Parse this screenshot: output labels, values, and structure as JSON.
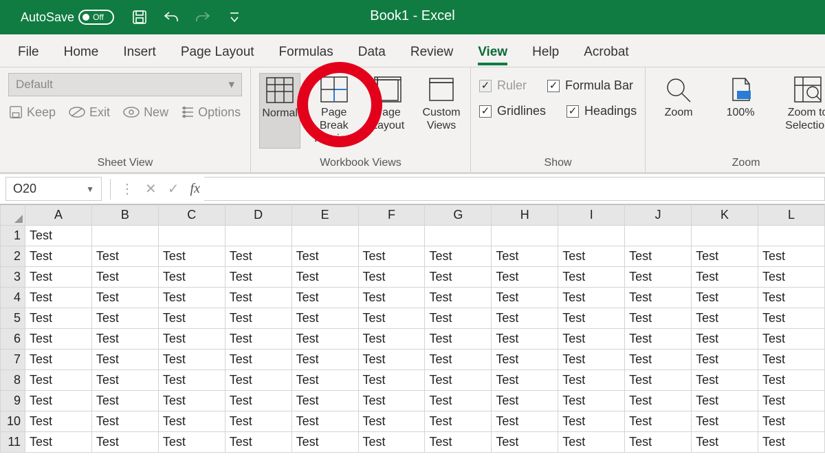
{
  "title": "Book1  -  Excel",
  "autosave": {
    "label": "AutoSave",
    "state": "Off"
  },
  "tabs": [
    "File",
    "Home",
    "Insert",
    "Page Layout",
    "Formulas",
    "Data",
    "Review",
    "View",
    "Help",
    "Acrobat"
  ],
  "active_tab": "View",
  "groups": {
    "sheet_view": {
      "label": "Sheet View",
      "select_value": "Default",
      "keep": "Keep",
      "exit": "Exit",
      "new": "New",
      "options": "Options"
    },
    "workbook_views": {
      "label": "Workbook Views",
      "normal": "Normal",
      "page_break": "Page Break Preview",
      "page_layout": "Page Layout",
      "custom_views": "Custom Views"
    },
    "show": {
      "label": "Show",
      "ruler": "Ruler",
      "gridlines": "Gridlines",
      "formula_bar": "Formula Bar",
      "headings": "Headings",
      "ruler_checked": true,
      "gridlines_checked": true,
      "formula_bar_checked": true,
      "headings_checked": true
    },
    "zoom": {
      "label": "Zoom",
      "zoom": "Zoom",
      "hundred": "100%",
      "selection": "Zoom to Selection"
    }
  },
  "formula_bar": {
    "name_box": "O20",
    "fx_label": "fx",
    "value": ""
  },
  "columns": [
    "A",
    "B",
    "C",
    "D",
    "E",
    "F",
    "G",
    "H",
    "I",
    "J",
    "K",
    "L"
  ],
  "rows": [
    {
      "n": 1,
      "cells": [
        "Test",
        "",
        "",
        "",
        "",
        "",
        "",
        "",
        "",
        "",
        "",
        ""
      ]
    },
    {
      "n": 2,
      "cells": [
        "Test",
        "Test",
        "Test",
        "Test",
        "Test",
        "Test",
        "Test",
        "Test",
        "Test",
        "Test",
        "Test",
        "Test"
      ]
    },
    {
      "n": 3,
      "cells": [
        "Test",
        "Test",
        "Test",
        "Test",
        "Test",
        "Test",
        "Test",
        "Test",
        "Test",
        "Test",
        "Test",
        "Test"
      ]
    },
    {
      "n": 4,
      "cells": [
        "Test",
        "Test",
        "Test",
        "Test",
        "Test",
        "Test",
        "Test",
        "Test",
        "Test",
        "Test",
        "Test",
        "Test"
      ]
    },
    {
      "n": 5,
      "cells": [
        "Test",
        "Test",
        "Test",
        "Test",
        "Test",
        "Test",
        "Test",
        "Test",
        "Test",
        "Test",
        "Test",
        "Test"
      ]
    },
    {
      "n": 6,
      "cells": [
        "Test",
        "Test",
        "Test",
        "Test",
        "Test",
        "Test",
        "Test",
        "Test",
        "Test",
        "Test",
        "Test",
        "Test"
      ]
    },
    {
      "n": 7,
      "cells": [
        "Test",
        "Test",
        "Test",
        "Test",
        "Test",
        "Test",
        "Test",
        "Test",
        "Test",
        "Test",
        "Test",
        "Test"
      ]
    },
    {
      "n": 8,
      "cells": [
        "Test",
        "Test",
        "Test",
        "Test",
        "Test",
        "Test",
        "Test",
        "Test",
        "Test",
        "Test",
        "Test",
        "Test"
      ]
    },
    {
      "n": 9,
      "cells": [
        "Test",
        "Test",
        "Test",
        "Test",
        "Test",
        "Test",
        "Test",
        "Test",
        "Test",
        "Test",
        "Test",
        "Test"
      ]
    },
    {
      "n": 10,
      "cells": [
        "Test",
        "Test",
        "Test",
        "Test",
        "Test",
        "Test",
        "Test",
        "Test",
        "Test",
        "Test",
        "Test",
        "Test"
      ]
    },
    {
      "n": 11,
      "cells": [
        "Test",
        "Test",
        "Test",
        "Test",
        "Test",
        "Test",
        "Test",
        "Test",
        "Test",
        "Test",
        "Test",
        "Test"
      ]
    }
  ]
}
